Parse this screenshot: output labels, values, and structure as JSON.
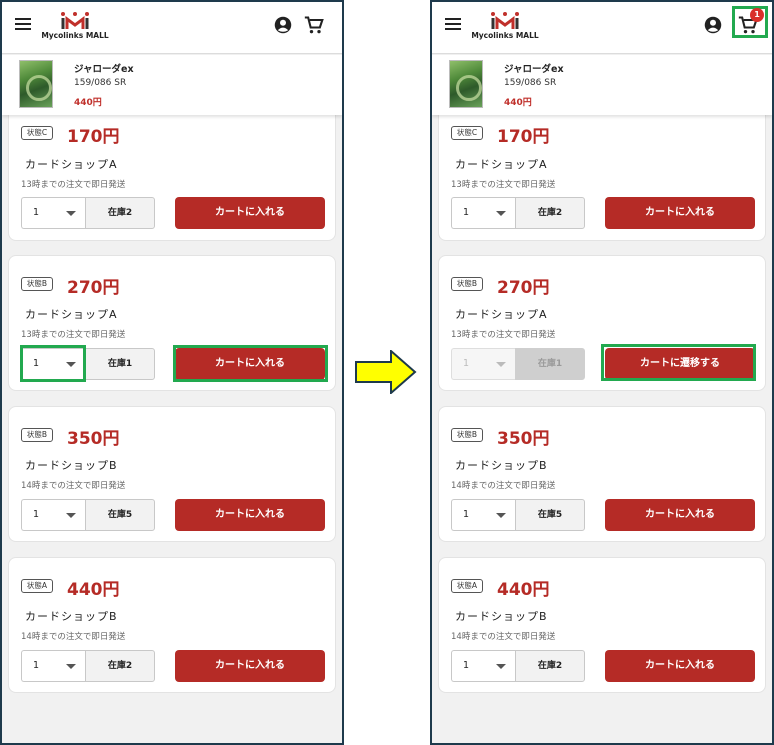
{
  "header": {
    "logo_text": "Mycolinks MALL"
  },
  "product": {
    "name": "ジャローダex",
    "number": "159/086 SR",
    "price": "440円"
  },
  "left_panel": {
    "listings": [
      {
        "condition": "状態C",
        "price": "170円",
        "shop": "カードショップA",
        "shipping": "13時までの注文で即日発送",
        "qty": "1",
        "stock": "在庫2",
        "button": "カートに入れる"
      },
      {
        "condition": "状態B",
        "price": "270円",
        "shop": "カードショップA",
        "shipping": "13時までの注文で即日発送",
        "qty": "1",
        "stock": "在庫1",
        "button": "カートに入れる"
      },
      {
        "condition": "状態B",
        "price": "350円",
        "shop": "カードショップB",
        "shipping": "14時までの注文で即日発送",
        "qty": "1",
        "stock": "在庫5",
        "button": "カートに入れる"
      },
      {
        "condition": "状態A",
        "price": "440円",
        "shop": "カードショップB",
        "shipping": "14時までの注文で即日発送",
        "qty": "1",
        "stock": "在庫2",
        "button": "カートに入れる"
      }
    ]
  },
  "right_panel": {
    "cart_badge": "1",
    "listings": [
      {
        "condition": "状態C",
        "price": "170円",
        "shop": "カードショップA",
        "shipping": "13時までの注文で即日発送",
        "qty": "1",
        "stock": "在庫2",
        "button": "カートに入れる"
      },
      {
        "condition": "状態B",
        "price": "270円",
        "shop": "カードショップA",
        "shipping": "13時までの注文で即日発送",
        "qty": "1",
        "stock": "在庫1",
        "button": "カートに遷移する"
      },
      {
        "condition": "状態B",
        "price": "350円",
        "shop": "カードショップB",
        "shipping": "14時までの注文で即日発送",
        "qty": "1",
        "stock": "在庫5",
        "button": "カートに入れる"
      },
      {
        "condition": "状態A",
        "price": "440円",
        "shop": "カードショップB",
        "shipping": "14時までの注文で即日発送",
        "qty": "1",
        "stock": "在庫2",
        "button": "カートに入れる"
      }
    ]
  },
  "colors": {
    "accent_red": "#b52b26",
    "highlight_green": "#22a94f",
    "arrow_yellow": "#ffff00"
  },
  "icons": [
    "menu-icon",
    "account-icon",
    "cart-icon",
    "chevron-down-icon",
    "right-arrow-icon"
  ]
}
